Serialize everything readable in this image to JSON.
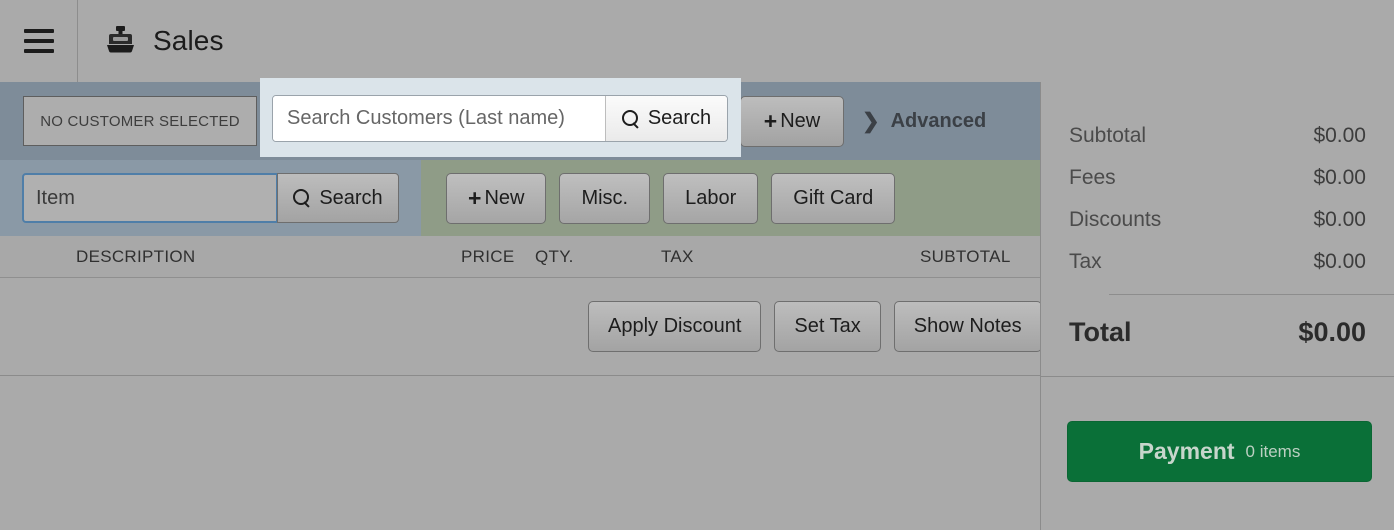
{
  "header": {
    "menu_icon": "hamburger-icon",
    "app_icon": "cash-register-icon",
    "title": "Sales"
  },
  "customer_bar": {
    "no_customer_label": "NO CUSTOMER SELECTED",
    "search_placeholder": "Search Customers (Last name)",
    "search_value": "",
    "search_button": "Search",
    "search_icon": "search-icon",
    "new_button": "New",
    "new_icon": "plus-icon",
    "advanced_label": "Advanced",
    "advanced_icon": "chevron-right-icon"
  },
  "item_bar": {
    "item_placeholder": "Item",
    "item_value": "",
    "search_button": "Search",
    "search_icon": "search-icon",
    "actions": [
      {
        "label": "New",
        "icon": "plus-icon"
      },
      {
        "label": "Misc.",
        "icon": ""
      },
      {
        "label": "Labor",
        "icon": ""
      },
      {
        "label": "Gift Card",
        "icon": ""
      }
    ]
  },
  "cart": {
    "columns": {
      "description": "DESCRIPTION",
      "price": "PRICE",
      "qty": "QTY.",
      "tax": "TAX",
      "subtotal": "SUBTOTAL"
    },
    "rows": [],
    "actions": [
      {
        "label": "Apply Discount"
      },
      {
        "label": "Set Tax"
      },
      {
        "label": "Show Notes"
      }
    ]
  },
  "totals": {
    "lines": [
      {
        "label": "Subtotal",
        "amount": "$0.00"
      },
      {
        "label": "Fees",
        "amount": "$0.00"
      },
      {
        "label": "Discounts",
        "amount": "$0.00"
      },
      {
        "label": "Tax",
        "amount": "$0.00"
      }
    ],
    "total_label": "Total",
    "total_amount": "$0.00"
  },
  "payment": {
    "label": "Payment",
    "items_count": "0 items",
    "color": "#0a7038"
  },
  "colors": {
    "page_background": "#aaaaaa",
    "customer_bar": "#7e8c99",
    "item_bar_left": "#8a99a6",
    "item_bar_right": "#8f9c87",
    "spotlight": "#dbe4ea",
    "payment_green": "#0a7038"
  }
}
